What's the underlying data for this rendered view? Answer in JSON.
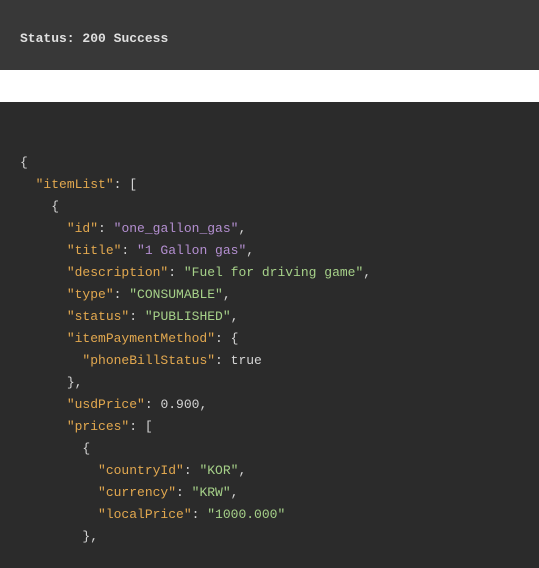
{
  "status": {
    "label": "Status:",
    "code": "200",
    "text": "Success"
  },
  "code": {
    "k_itemList": "\"itemList\"",
    "k_id": "\"id\"",
    "v_id": "\"one_gallon_gas\"",
    "k_title": "\"title\"",
    "v_title": "\"1 Gallon gas\"",
    "k_description": "\"description\"",
    "v_description": "\"Fuel for driving game\"",
    "k_type": "\"type\"",
    "v_type": "\"CONSUMABLE\"",
    "k_status": "\"status\"",
    "v_status": "\"PUBLISHED\"",
    "k_itemPaymentMethod": "\"itemPaymentMethod\"",
    "k_phoneBillStatus": "\"phoneBillStatus\"",
    "v_phoneBillStatus": "true",
    "k_usdPrice": "\"usdPrice\"",
    "v_usdPrice": "0.900",
    "k_prices": "\"prices\"",
    "k_countryId": "\"countryId\"",
    "v_countryId": "\"KOR\"",
    "k_currency": "\"currency\"",
    "v_currency": "\"KRW\"",
    "k_localPrice": "\"localPrice\"",
    "v_localPrice": "\"1000.000\""
  }
}
